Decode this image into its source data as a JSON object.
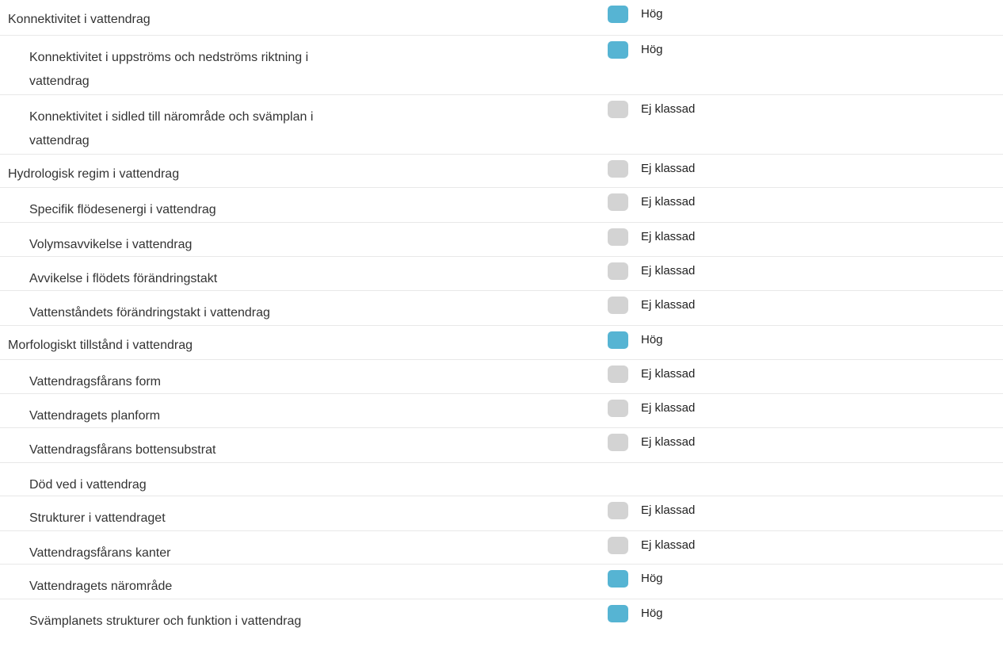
{
  "statuses": {
    "hog": {
      "label": "Hög",
      "color": "#56b4d3"
    },
    "ej": {
      "label": "Ej klassad",
      "color": "#d3d3d3"
    }
  },
  "rows": [
    {
      "label": "Konnektivitet i vattendrag",
      "level": 0,
      "status": "hog"
    },
    {
      "label": "Konnektivitet i uppströms och nedströms riktning i vattendrag",
      "level": 1,
      "status": "hog"
    },
    {
      "label": "Konnektivitet i sidled till närområde och svämplan i vattendrag",
      "level": 1,
      "status": "ej"
    },
    {
      "label": "Hydrologisk regim i vattendrag",
      "level": 0,
      "status": "ej"
    },
    {
      "label": "Specifik flödesenergi i vattendrag",
      "level": 1,
      "status": "ej"
    },
    {
      "label": "Volymsavvikelse i vattendrag",
      "level": 1,
      "status": "ej"
    },
    {
      "label": "Avvikelse i flödets förändringstakt",
      "level": 1,
      "status": "ej"
    },
    {
      "label": "Vattenståndets förändringstakt i vattendrag",
      "level": 1,
      "status": "ej"
    },
    {
      "label": "Morfologiskt tillstånd i vattendrag",
      "level": 0,
      "status": "hog"
    },
    {
      "label": "Vattendragsfårans form",
      "level": 1,
      "status": "ej"
    },
    {
      "label": "Vattendragets planform",
      "level": 1,
      "status": "ej"
    },
    {
      "label": "Vattendragsfårans bottensubstrat",
      "level": 1,
      "status": "ej"
    },
    {
      "label": "Död ved i vattendrag",
      "level": 1,
      "status": null
    },
    {
      "label": "Strukturer i vattendraget",
      "level": 1,
      "status": "ej"
    },
    {
      "label": "Vattendragsfårans kanter",
      "level": 1,
      "status": "ej"
    },
    {
      "label": "Vattendragets närområde",
      "level": 1,
      "status": "hog"
    },
    {
      "label": "Svämplanets strukturer och funktion i vattendrag",
      "level": 1,
      "status": "hog"
    }
  ]
}
